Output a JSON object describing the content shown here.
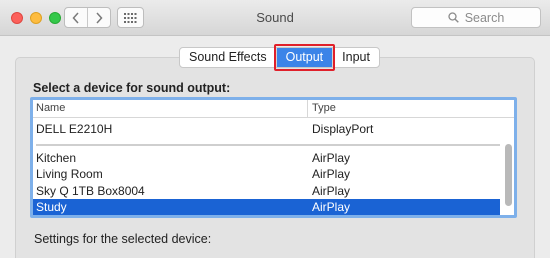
{
  "window": {
    "title": "Sound"
  },
  "toolbar": {
    "search_placeholder": "Search"
  },
  "tabs": [
    {
      "label": "Sound Effects"
    },
    {
      "label": "Output",
      "selected": true
    },
    {
      "label": "Input"
    }
  ],
  "output": {
    "section_label": "Select a device for sound output:",
    "columns": {
      "name": "Name",
      "type": "Type"
    },
    "devices": [
      {
        "name": "DELL E2210H",
        "type": "DisplayPort"
      },
      {
        "name": "Kitchen",
        "type": "AirPlay"
      },
      {
        "name": "Living Room",
        "type": "AirPlay"
      },
      {
        "name": "Sky Q 1TB Box8004",
        "type": "AirPlay"
      },
      {
        "name": "Study",
        "type": "AirPlay",
        "selected": true
      }
    ],
    "settings_label": "Settings for the selected device:"
  },
  "colors": {
    "accent": "#1a63d4",
    "highlight_outline": "#e0202a",
    "close": "#fc605b",
    "minimize": "#fdbc40",
    "maximize": "#34c84a"
  },
  "icons": [
    "close-icon",
    "minimize-icon",
    "maximize-icon",
    "chevron-left-icon",
    "chevron-right-icon",
    "grid-icon",
    "search-icon"
  ]
}
